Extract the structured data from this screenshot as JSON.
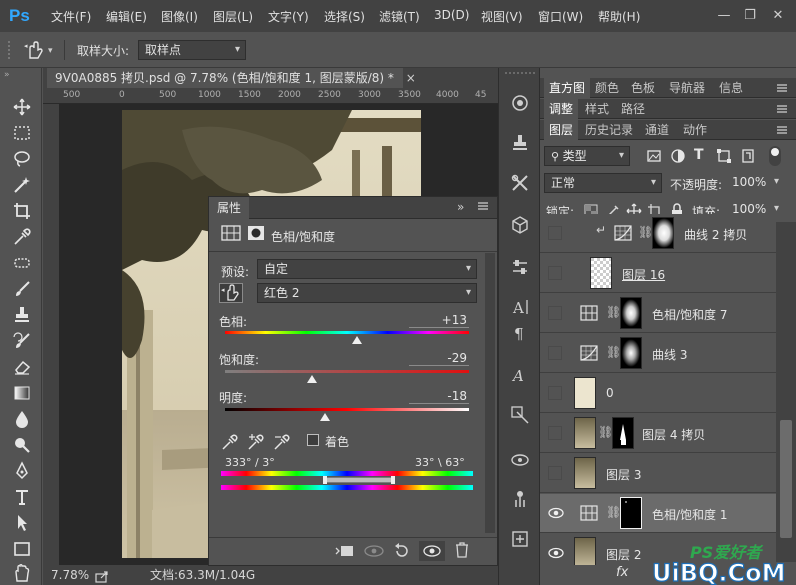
{
  "app": {
    "logo": "Ps"
  },
  "menu": [
    "文件(F)",
    "编辑(E)",
    "图像(I)",
    "图层(L)",
    "文字(Y)",
    "选择(S)",
    "滤镜(T)",
    "3D(D)",
    "视图(V)",
    "窗口(W)",
    "帮助(H)"
  ],
  "window_controls": {
    "minimize": "—",
    "restore": "❐",
    "close": "✕"
  },
  "options": {
    "sample_size_label": "取样大小:",
    "sample_size_value": "取样点"
  },
  "document": {
    "tab_title": "9V0A0885 拷贝.psd @ 7.78% (色相/饱和度 1, 图层蒙版/8) *",
    "tab_close": "×",
    "ruler_ticks": [
      "500",
      "0",
      "500",
      "1000",
      "1500",
      "2000",
      "2500",
      "3000",
      "3500",
      "4000",
      "45"
    ],
    "zoom": "7.78%",
    "status": "文档:63.3M/1.04G"
  },
  "properties": {
    "tab": "属性",
    "title": "色相/饱和度",
    "preset_label": "预设:",
    "preset_value": "自定",
    "channel_value": "红色 2",
    "hue_label": "色相:",
    "hue_value": "+13",
    "hue_fraction": 0.54,
    "saturation_label": "饱和度:",
    "saturation_value": "-29",
    "saturation_fraction": 0.355,
    "lightness_label": "明度:",
    "lightness_value": "-18",
    "lightness_fraction": 0.41,
    "colorize_label": "着色",
    "range_left": "333° / 3°",
    "range_right": "33° \\ 63°",
    "collapse": "»"
  },
  "panels": {
    "row1_tabs": [
      "直方图",
      "颜色",
      "色板",
      "导航器",
      "信息"
    ],
    "row2_tabs": [
      "调整",
      "样式",
      "路径"
    ],
    "row3_tabs": [
      "图层",
      "历史记录",
      "通道",
      "动作"
    ],
    "filter_kind": "类型",
    "blend_mode": "正常",
    "opacity_label": "不透明度:",
    "opacity_value": "100%",
    "lock_label": "锁定:",
    "fill_label": "填充:",
    "fill_value": "100%"
  },
  "layers": [
    {
      "name": "曲线 2 拷贝",
      "type": "curves-clipped",
      "visible": false
    },
    {
      "name": "图层 16",
      "type": "pixel-transparent",
      "visible": false
    },
    {
      "name": "色相/饱和度 7",
      "type": "hue-sat",
      "visible": false
    },
    {
      "name": "曲线 3",
      "type": "curves",
      "visible": false
    },
    {
      "name": "0",
      "type": "pixel-cream",
      "visible": false
    },
    {
      "name": "图层 4 拷贝",
      "type": "pixel-mask",
      "visible": false
    },
    {
      "name": "图层 3",
      "type": "pixel-photo",
      "visible": false
    },
    {
      "name": "色相/饱和度 1",
      "type": "hue-sat-selected",
      "visible": true
    },
    {
      "name": "图层 2",
      "type": "pixel-photo",
      "visible": true
    }
  ],
  "layers_footer": {
    "fx": "fx"
  },
  "watermark": {
    "text1": "PS爱好者",
    "text2": "UiBQ.CoM"
  }
}
